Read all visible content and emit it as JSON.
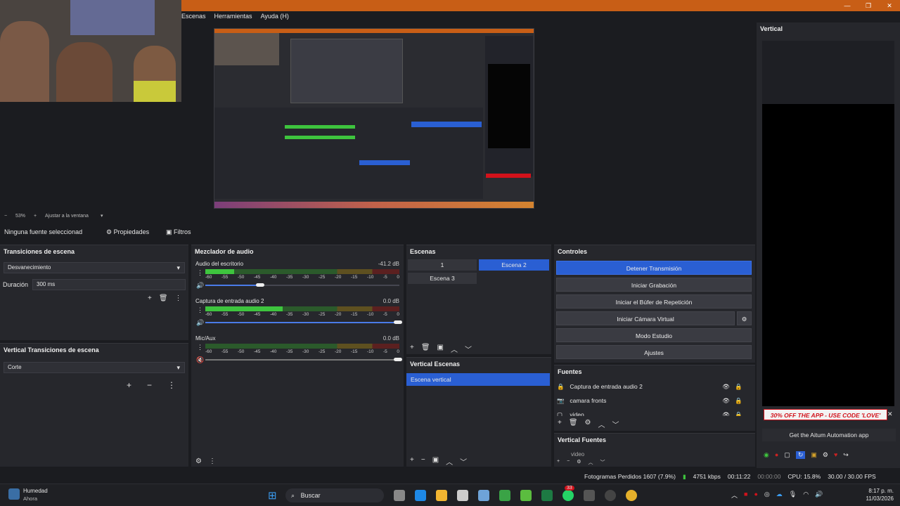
{
  "window": {
    "min": "—",
    "max": "❐",
    "close": "✕"
  },
  "menu": [
    "Escenas",
    "Herramientas",
    "Ayuda (H)"
  ],
  "zoom": {
    "level": "53%",
    "fit": "Ajustar a la ventana"
  },
  "source_bar": {
    "status": "Ninguna fuente seleccionad",
    "properties": "Propiedades",
    "filters": "Filtros"
  },
  "transitions": {
    "title": "Transiciones de escena",
    "selected": "Desvanecimiento",
    "duration_label": "Duración",
    "duration_value": "300 ms"
  },
  "vertical_transitions": {
    "title": "Vertical Transiciones de escena",
    "selected": "Corte"
  },
  "mixer": {
    "title": "Mezclador de audio",
    "ticks": [
      "-60",
      "-55",
      "-50",
      "-45",
      "-40",
      "-35",
      "-30",
      "-25",
      "-20",
      "-15",
      "-10",
      "-5",
      "0"
    ],
    "channels": [
      {
        "name": "Audio del escritorio",
        "db": "-41.2 dB",
        "level": 0.15,
        "volume": 0.29
      },
      {
        "name": "Captura de entrada audio 2",
        "db": "0.0 dB",
        "level": 0.4,
        "volume": 1.0
      },
      {
        "name": "Mic/Aux",
        "db": "0.0 dB",
        "level": 0.0,
        "volume": 1.0
      }
    ]
  },
  "scenes": {
    "title": "Escenas",
    "items": [
      "1",
      "Escena 2",
      "Escena 3"
    ],
    "active": "Escena 2"
  },
  "vertical_scenes": {
    "title": "Vertical Escenas",
    "items": [
      "Escena vertical"
    ]
  },
  "controls": {
    "title": "Controles",
    "stop_stream": "Detener Transmisión",
    "start_recording": "Iniciar Grabación",
    "replay_buffer": "Iniciar el Búfer de Repetición",
    "virtual_cam": "Iniciar Cámara Virtual",
    "studio_mode": "Modo Estudio",
    "settings": "Ajustes"
  },
  "sources": {
    "title": "Fuentes",
    "items": [
      "Captura de entrada audio 2",
      "camara fronts",
      "video"
    ]
  },
  "vertical_sources": {
    "title": "Vertical Fuentes",
    "items": [
      "video"
    ]
  },
  "vertical": {
    "title": "Vertical",
    "ad": "30% OFF THE APP - USE CODE 'LOVE'",
    "ad_link": "Get the Aitum Automation app"
  },
  "status": {
    "dropped": "Fotogramas Perdidos 1607 (7.9%)",
    "bitrate": "4751 kbps",
    "stream_time": "00:11:22",
    "rec_time": "00:00:00",
    "cpu": "CPU: 15.8%",
    "fps": "30.00 / 30.00 FPS"
  },
  "taskbar": {
    "weather": "Humedad",
    "weather_sub": "Ahora",
    "search": "Buscar",
    "time": "8:17 p. m.",
    "date": "11/03/2026",
    "badge": "33"
  },
  "colors": {
    "accent": "#2a5fd3",
    "meter_green": "#3ec43e",
    "meter_yellow": "#c3a52a",
    "meter_red": "#b32b2b",
    "titlebar": "#c85e16"
  }
}
